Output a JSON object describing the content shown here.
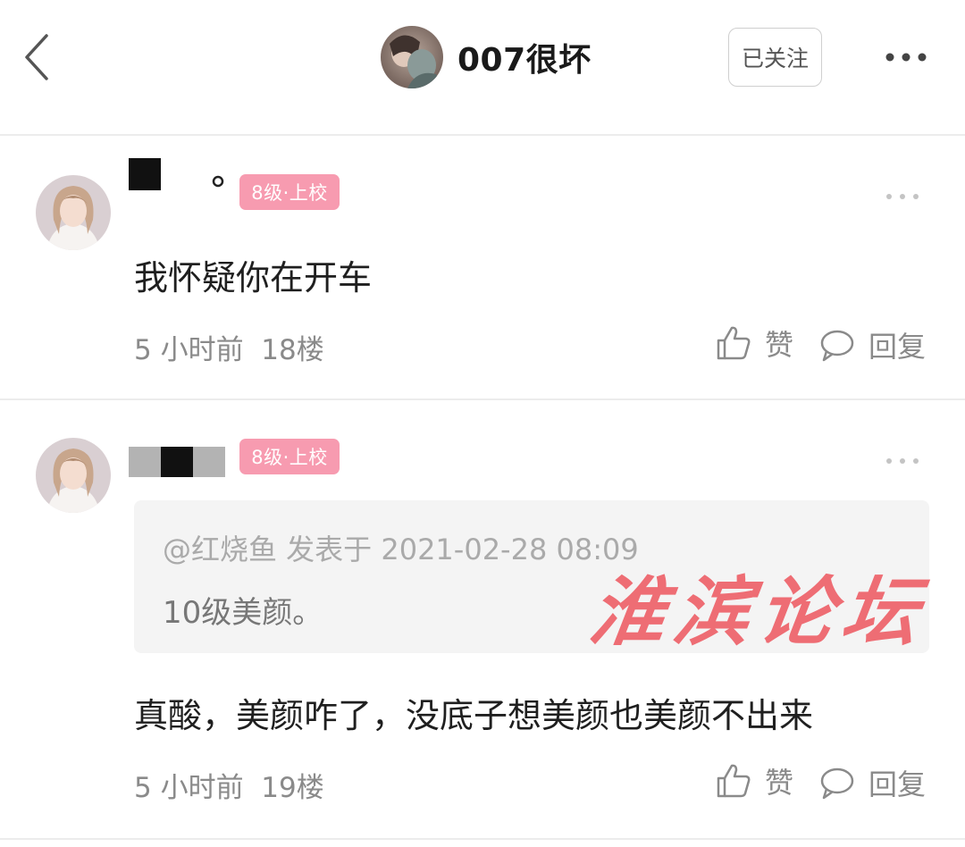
{
  "header": {
    "title": "007很坏",
    "follow_label": "已关注"
  },
  "posts": [
    {
      "level": "8级·上校",
      "content": "我怀疑你在开车",
      "time": "5 小时前",
      "floor": "18楼",
      "like_label": "赞",
      "reply_label": "回复"
    },
    {
      "level": "8级·上校",
      "quote": {
        "header": "@红烧鱼 发表于 2021-02-28 08:09",
        "text": "10级美颜。"
      },
      "content": "真酸，美颜咋了，没底子想美颜也美颜不出来",
      "time": "5 小时前",
      "floor": "19楼",
      "like_label": "赞",
      "reply_label": "回复"
    }
  ],
  "watermark": "淮滨论坛",
  "icons": {
    "back": "chevron-left-icon",
    "more": "more-horizontal-icon",
    "like": "thumbs-up-icon",
    "reply": "comment-bubble-icon"
  },
  "colors": {
    "level_badge": "#f79bb0",
    "watermark": "#ee6d74",
    "meta_text": "#8a8a8a",
    "quote_bg": "#f4f4f4"
  }
}
